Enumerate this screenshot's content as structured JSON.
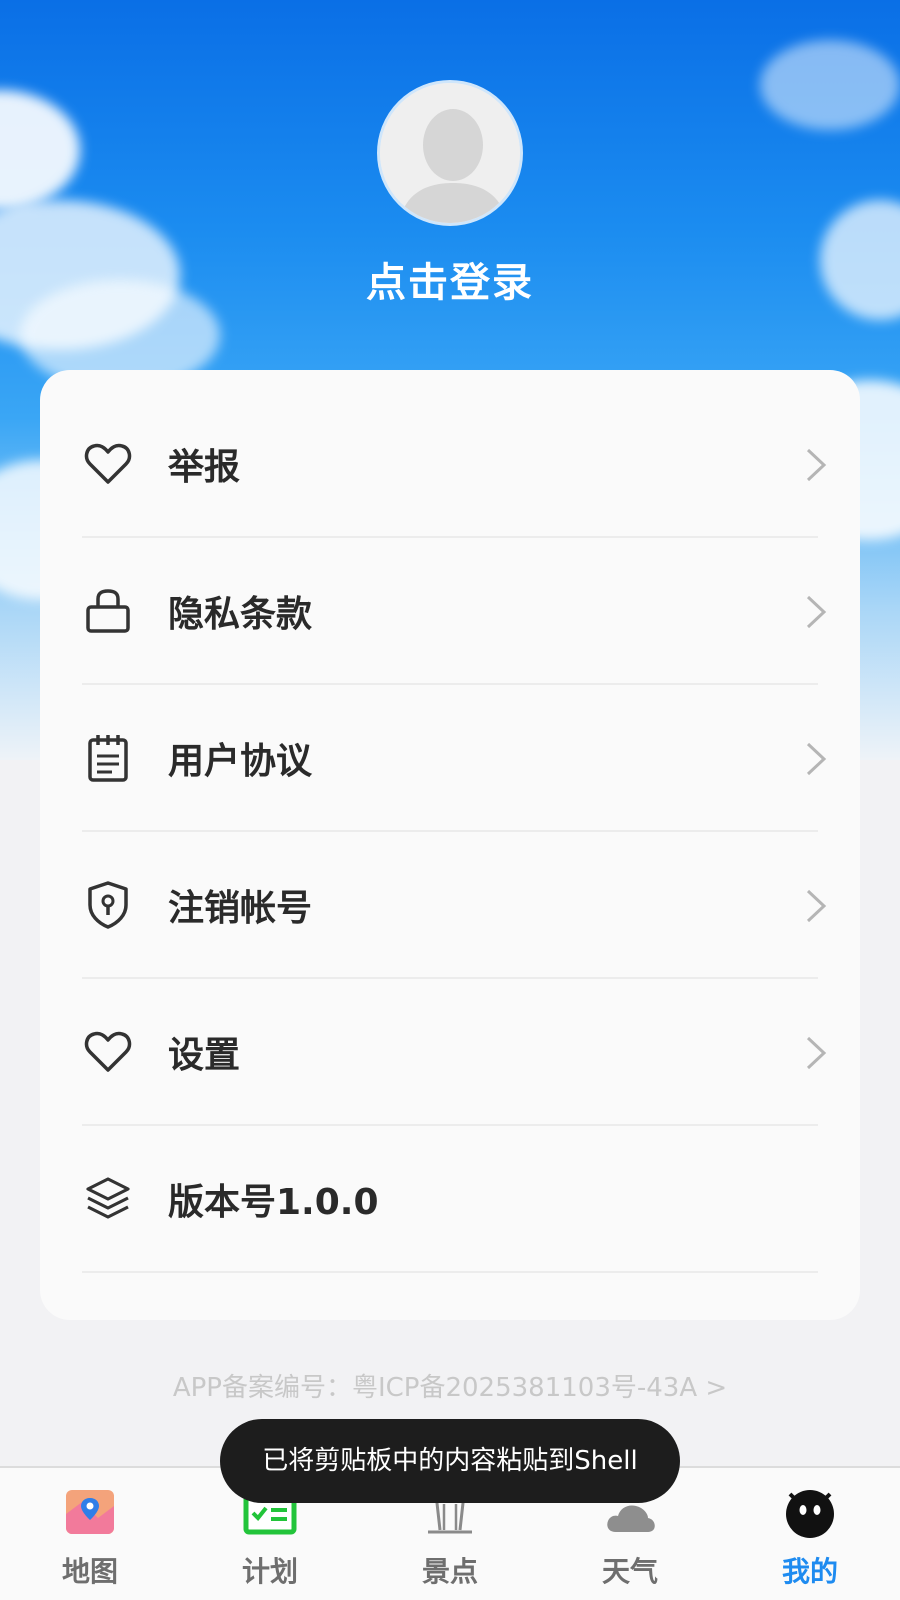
{
  "header": {
    "login_text": "点击登录",
    "avatar_icon": "default-avatar-icon"
  },
  "menu": {
    "items": [
      {
        "label": "举报",
        "icon": "heart-icon",
        "has_chevron": true
      },
      {
        "label": "隐私条款",
        "icon": "lock-icon",
        "has_chevron": true
      },
      {
        "label": "用户协议",
        "icon": "notepad-icon",
        "has_chevron": true
      },
      {
        "label": "注销帐号",
        "icon": "shield-keyhole-icon",
        "has_chevron": true
      },
      {
        "label": "设置",
        "icon": "heart-icon",
        "has_chevron": true
      },
      {
        "label": "版本号1.0.0",
        "icon": "layers-icon",
        "has_chevron": false
      }
    ]
  },
  "footer": {
    "icp": "APP备案编号：粤ICP备2025381103号-43A >"
  },
  "toast": {
    "text": "已将剪贴板中的内容粘贴到Shell"
  },
  "tabbar": {
    "tabs": [
      {
        "label": "地图",
        "icon": "map-icon",
        "active": false
      },
      {
        "label": "计划",
        "icon": "checklist-icon",
        "active": false
      },
      {
        "label": "景点",
        "icon": "landmark-icon",
        "active": false
      },
      {
        "label": "天气",
        "icon": "cloud-icon",
        "active": false
      },
      {
        "label": "我的",
        "icon": "mascot-icon",
        "active": true
      }
    ]
  },
  "colors": {
    "accent": "#1e8bf0",
    "sky_top": "#0a6fe6",
    "tab_inactive": "#6e6e6e"
  }
}
